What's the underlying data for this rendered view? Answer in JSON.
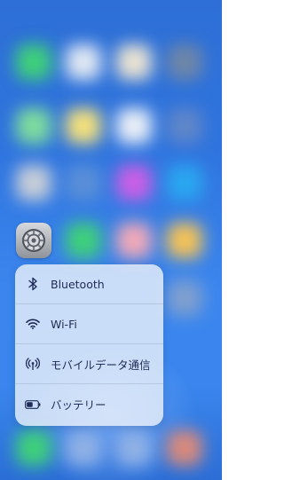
{
  "home_screen": {
    "wallpaper_color": "#2f74de",
    "blurred_icon_colors": [
      [
        "#3fd07a",
        "#dfe7f2",
        "#e9e2d2",
        "#6f86a8"
      ],
      [
        "#7edc9d",
        "#f4e07c",
        "#e9eef6",
        "#5f86c9"
      ],
      [
        "#c7cdd7",
        "#5a8fd8",
        "#ca5fe6",
        "#2aa7f0"
      ],
      [
        null,
        "#3fd07a",
        "#f1a9b8",
        "#f4c257"
      ],
      [
        null,
        null,
        null,
        "#7f9fcf"
      ],
      [
        "#3fd07a",
        "#8fb1e6",
        "#8fb1e6",
        "#d98a7a"
      ]
    ]
  },
  "app": {
    "icon": "settings-gear-icon"
  },
  "quick_actions": [
    {
      "icon": "bluetooth-icon",
      "label": "Bluetooth"
    },
    {
      "icon": "wifi-icon",
      "label": "Wi-Fi"
    },
    {
      "icon": "cellular-antenna-icon",
      "label": "モバイルデータ通信"
    },
    {
      "icon": "battery-icon",
      "label": "バッテリー"
    }
  ]
}
